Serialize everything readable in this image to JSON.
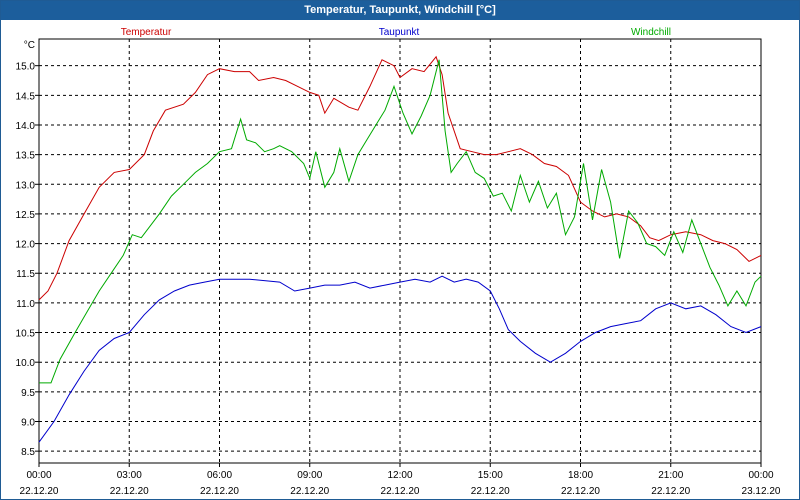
{
  "window": {
    "title": "Temperatur, Taupunkt, Windchill [°C]"
  },
  "chart_data": {
    "type": "line",
    "title": "Temperatur, Taupunkt, Windchill [°C]",
    "ylabel": "°C",
    "ylim": [
      8.3,
      15.45
    ],
    "yticks": [
      8.5,
      9.0,
      9.5,
      10.0,
      10.5,
      11.0,
      11.5,
      12.0,
      12.5,
      13.0,
      13.5,
      14.0,
      14.5,
      15.0
    ],
    "xlim": [
      0,
      24
    ],
    "xticks": [
      {
        "h": 0,
        "time": "00:00",
        "date": "22.12.20"
      },
      {
        "h": 3,
        "time": "03:00",
        "date": "22.12.20"
      },
      {
        "h": 6,
        "time": "06:00",
        "date": "22.12.20"
      },
      {
        "h": 9,
        "time": "09:00",
        "date": "22.12.20"
      },
      {
        "h": 12,
        "time": "12:00",
        "date": "22.12.20"
      },
      {
        "h": 15,
        "time": "15:00",
        "date": "22.12.20"
      },
      {
        "h": 18,
        "time": "18:00",
        "date": "22.12.20"
      },
      {
        "h": 21,
        "time": "21:00",
        "date": "22.12.20"
      },
      {
        "h": 24,
        "time": "00:00",
        "date": "23.12.20"
      }
    ],
    "grid": true,
    "legend_position": "top",
    "series": [
      {
        "name": "Temperatur",
        "color": "#cc0000",
        "points": [
          [
            0,
            11.05
          ],
          [
            0.3,
            11.2
          ],
          [
            0.6,
            11.5
          ],
          [
            1.0,
            12.05
          ],
          [
            1.5,
            12.5
          ],
          [
            2.0,
            12.95
          ],
          [
            2.5,
            13.2
          ],
          [
            3.0,
            13.25
          ],
          [
            3.5,
            13.5
          ],
          [
            3.8,
            13.9
          ],
          [
            4.2,
            14.25
          ],
          [
            4.8,
            14.35
          ],
          [
            5.2,
            14.55
          ],
          [
            5.6,
            14.85
          ],
          [
            6.0,
            14.95
          ],
          [
            6.5,
            14.9
          ],
          [
            7.0,
            14.9
          ],
          [
            7.3,
            14.75
          ],
          [
            7.8,
            14.8
          ],
          [
            8.2,
            14.75
          ],
          [
            8.6,
            14.65
          ],
          [
            9.0,
            14.55
          ],
          [
            9.3,
            14.5
          ],
          [
            9.5,
            14.2
          ],
          [
            9.8,
            14.45
          ],
          [
            10.3,
            14.3
          ],
          [
            10.6,
            14.25
          ],
          [
            11.0,
            14.65
          ],
          [
            11.4,
            15.1
          ],
          [
            11.8,
            15.0
          ],
          [
            12.0,
            14.8
          ],
          [
            12.4,
            14.95
          ],
          [
            12.8,
            14.9
          ],
          [
            13.2,
            15.15
          ],
          [
            13.4,
            14.85
          ],
          [
            13.6,
            14.2
          ],
          [
            14.0,
            13.6
          ],
          [
            14.4,
            13.55
          ],
          [
            14.8,
            13.5
          ],
          [
            15.2,
            13.5
          ],
          [
            15.6,
            13.55
          ],
          [
            16.0,
            13.6
          ],
          [
            16.4,
            13.5
          ],
          [
            16.8,
            13.35
          ],
          [
            17.2,
            13.3
          ],
          [
            17.6,
            13.15
          ],
          [
            18.0,
            12.7
          ],
          [
            18.4,
            12.55
          ],
          [
            18.8,
            12.45
          ],
          [
            19.2,
            12.5
          ],
          [
            19.6,
            12.45
          ],
          [
            20.0,
            12.3
          ],
          [
            20.3,
            12.1
          ],
          [
            20.6,
            12.05
          ],
          [
            21.0,
            12.15
          ],
          [
            21.5,
            12.2
          ],
          [
            22.0,
            12.15
          ],
          [
            22.4,
            12.05
          ],
          [
            22.8,
            12.0
          ],
          [
            23.2,
            11.9
          ],
          [
            23.6,
            11.7
          ],
          [
            24.0,
            11.8
          ]
        ]
      },
      {
        "name": "Taupunkt",
        "color": "#0000cc",
        "points": [
          [
            0,
            8.65
          ],
          [
            0.5,
            9.0
          ],
          [
            1.0,
            9.45
          ],
          [
            1.5,
            9.85
          ],
          [
            2.0,
            10.2
          ],
          [
            2.5,
            10.4
          ],
          [
            3.0,
            10.5
          ],
          [
            3.5,
            10.8
          ],
          [
            4.0,
            11.05
          ],
          [
            4.5,
            11.2
          ],
          [
            5.0,
            11.3
          ],
          [
            5.5,
            11.35
          ],
          [
            6.0,
            11.4
          ],
          [
            7.0,
            11.4
          ],
          [
            8.0,
            11.35
          ],
          [
            8.5,
            11.2
          ],
          [
            9.0,
            11.25
          ],
          [
            9.5,
            11.3
          ],
          [
            10.0,
            11.3
          ],
          [
            10.5,
            11.35
          ],
          [
            11.0,
            11.25
          ],
          [
            11.5,
            11.3
          ],
          [
            12.0,
            11.35
          ],
          [
            12.5,
            11.4
          ],
          [
            13.0,
            11.35
          ],
          [
            13.4,
            11.45
          ],
          [
            13.8,
            11.35
          ],
          [
            14.2,
            11.4
          ],
          [
            14.6,
            11.35
          ],
          [
            15.0,
            11.2
          ],
          [
            15.3,
            10.9
          ],
          [
            15.6,
            10.55
          ],
          [
            16.0,
            10.35
          ],
          [
            16.5,
            10.15
          ],
          [
            17.0,
            10.0
          ],
          [
            17.5,
            10.15
          ],
          [
            18.0,
            10.35
          ],
          [
            18.5,
            10.5
          ],
          [
            19.0,
            10.6
          ],
          [
            19.5,
            10.65
          ],
          [
            20.0,
            10.7
          ],
          [
            20.5,
            10.9
          ],
          [
            21.0,
            11.0
          ],
          [
            21.5,
            10.9
          ],
          [
            22.0,
            10.95
          ],
          [
            22.5,
            10.8
          ],
          [
            23.0,
            10.6
          ],
          [
            23.5,
            10.5
          ],
          [
            24.0,
            10.6
          ]
        ]
      },
      {
        "name": "Windchill",
        "color": "#00aa00",
        "points": [
          [
            0,
            9.65
          ],
          [
            0.4,
            9.65
          ],
          [
            0.7,
            10.05
          ],
          [
            1.2,
            10.5
          ],
          [
            1.6,
            10.85
          ],
          [
            2.0,
            11.2
          ],
          [
            2.4,
            11.5
          ],
          [
            2.8,
            11.8
          ],
          [
            3.1,
            12.15
          ],
          [
            3.4,
            12.1
          ],
          [
            3.7,
            12.3
          ],
          [
            4.0,
            12.5
          ],
          [
            4.4,
            12.8
          ],
          [
            4.8,
            13.0
          ],
          [
            5.2,
            13.2
          ],
          [
            5.6,
            13.35
          ],
          [
            6.0,
            13.55
          ],
          [
            6.4,
            13.6
          ],
          [
            6.7,
            14.1
          ],
          [
            6.9,
            13.75
          ],
          [
            7.2,
            13.7
          ],
          [
            7.5,
            13.55
          ],
          [
            7.8,
            13.6
          ],
          [
            8.0,
            13.65
          ],
          [
            8.4,
            13.55
          ],
          [
            8.8,
            13.35
          ],
          [
            9.0,
            13.1
          ],
          [
            9.2,
            13.55
          ],
          [
            9.5,
            12.95
          ],
          [
            9.8,
            13.2
          ],
          [
            10.0,
            13.6
          ],
          [
            10.3,
            13.05
          ],
          [
            10.6,
            13.5
          ],
          [
            10.9,
            13.75
          ],
          [
            11.2,
            14.0
          ],
          [
            11.5,
            14.25
          ],
          [
            11.8,
            14.65
          ],
          [
            12.1,
            14.2
          ],
          [
            12.4,
            13.85
          ],
          [
            12.7,
            14.15
          ],
          [
            13.0,
            14.5
          ],
          [
            13.3,
            15.1
          ],
          [
            13.5,
            13.9
          ],
          [
            13.7,
            13.2
          ],
          [
            13.9,
            13.35
          ],
          [
            14.2,
            13.55
          ],
          [
            14.5,
            13.2
          ],
          [
            14.8,
            13.1
          ],
          [
            15.1,
            12.8
          ],
          [
            15.4,
            12.85
          ],
          [
            15.7,
            12.55
          ],
          [
            16.0,
            13.15
          ],
          [
            16.3,
            12.7
          ],
          [
            16.6,
            13.05
          ],
          [
            16.9,
            12.6
          ],
          [
            17.2,
            12.85
          ],
          [
            17.5,
            12.15
          ],
          [
            17.8,
            12.45
          ],
          [
            18.1,
            13.35
          ],
          [
            18.4,
            12.4
          ],
          [
            18.7,
            13.25
          ],
          [
            19.0,
            12.7
          ],
          [
            19.3,
            11.75
          ],
          [
            19.6,
            12.55
          ],
          [
            19.9,
            12.35
          ],
          [
            20.2,
            12.0
          ],
          [
            20.5,
            11.95
          ],
          [
            20.8,
            11.8
          ],
          [
            21.1,
            12.2
          ],
          [
            21.4,
            11.85
          ],
          [
            21.7,
            12.4
          ],
          [
            22.0,
            12.0
          ],
          [
            22.3,
            11.6
          ],
          [
            22.6,
            11.3
          ],
          [
            22.9,
            10.95
          ],
          [
            23.2,
            11.2
          ],
          [
            23.5,
            10.95
          ],
          [
            23.8,
            11.35
          ],
          [
            24.0,
            11.45
          ]
        ]
      }
    ]
  }
}
